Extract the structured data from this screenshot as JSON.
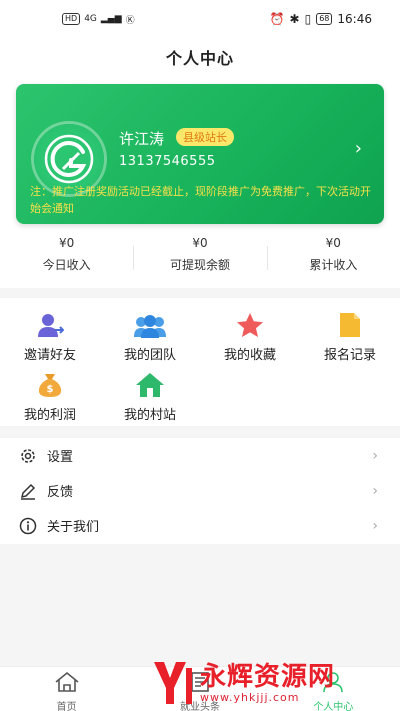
{
  "status_bar": {
    "hd": "HD",
    "network": "4G",
    "time": "16:46",
    "battery": "68"
  },
  "header": {
    "title": "个人中心"
  },
  "profile": {
    "name": "许江涛",
    "level": "县级站长",
    "phone": "13137546555",
    "notice": "注：推广注册奖励活动已经截止，现阶段推广为免费推广，下次活动开始会通知"
  },
  "stats": [
    {
      "amount": "¥0",
      "label": "今日收入"
    },
    {
      "amount": "¥0",
      "label": "可提现余额"
    },
    {
      "amount": "¥0",
      "label": "累计收入"
    }
  ],
  "grid": [
    {
      "label": "邀请好友",
      "icon": "invite-user-icon"
    },
    {
      "label": "我的团队",
      "icon": "team-icon"
    },
    {
      "label": "我的收藏",
      "icon": "star-icon"
    },
    {
      "label": "报名记录",
      "icon": "document-icon"
    },
    {
      "label": "我的利润",
      "icon": "money-bag-icon"
    },
    {
      "label": "我的村站",
      "icon": "house-icon"
    }
  ],
  "menu": [
    {
      "label": "设置",
      "icon": "gear-icon"
    },
    {
      "label": "反馈",
      "icon": "pen-icon"
    },
    {
      "label": "关于我们",
      "icon": "info-icon"
    }
  ],
  "tabbar": [
    {
      "label": "首页",
      "icon": "home-icon"
    },
    {
      "label": "就业头条",
      "icon": "news-icon"
    },
    {
      "label": "个人中心",
      "icon": "profile-icon"
    }
  ],
  "watermark": {
    "text": "永辉资源网",
    "url": "www.yhkjjj.com"
  },
  "colors": {
    "brand_green": "#2dc46e",
    "badge_yellow": "#fbe86b",
    "notice_yellow": "#f6e04a"
  }
}
